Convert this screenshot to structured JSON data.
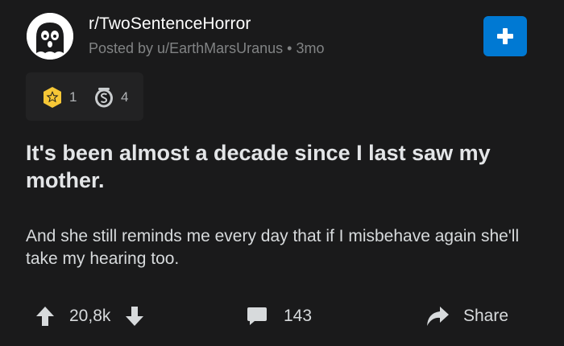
{
  "header": {
    "subreddit": "r/TwoSentenceHorror",
    "posted_by": "Posted by u/EarthMarsUranus",
    "separator": "•",
    "age": "3mo",
    "join_icon": "plus-icon"
  },
  "awards": [
    {
      "icon": "star-award-icon",
      "count": "1"
    },
    {
      "icon": "silver-coin-award-icon",
      "count": "4"
    }
  ],
  "post": {
    "title": "It's been almost a decade since I last saw my mother.",
    "body": "And she still reminds me every day that if I misbehave again she'll take my hearing too."
  },
  "actions": {
    "upvote_icon": "arrow-up-icon",
    "score": "20,8k",
    "downvote_icon": "arrow-down-icon",
    "comment_icon": "comment-icon",
    "comments": "143",
    "share_icon": "share-icon",
    "share_label": "Share"
  },
  "colors": {
    "background": "#1a1a1b",
    "join_button": "#0079d3",
    "muted_text": "#818384",
    "award_gold": "#f6c736"
  }
}
